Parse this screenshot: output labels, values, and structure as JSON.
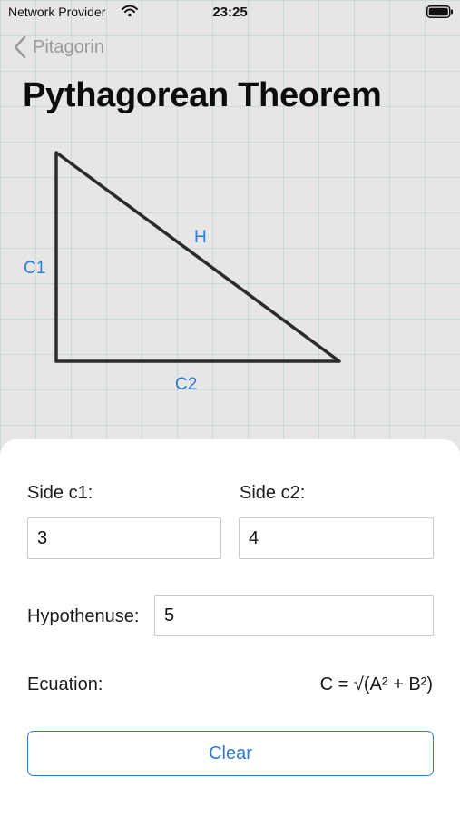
{
  "status_bar": {
    "carrier": "Network Provider",
    "time": "23:25"
  },
  "nav": {
    "back_label": "Pitagorin",
    "title": "Pythagorean Theorem"
  },
  "diagram": {
    "label_c1": "C1",
    "label_h": "H",
    "label_c2": "C2"
  },
  "form": {
    "side1_label": "Side c1:",
    "side1_value": "3",
    "side2_label": "Side c2:",
    "side2_value": "4",
    "hypotenuse_label": "Hypothenuse:",
    "hypotenuse_value": "5",
    "equation_label": "Ecuation:",
    "equation_text": "C = √(A² + B²)",
    "clear_label": "Clear"
  },
  "colors": {
    "accent": "#2f7bd6",
    "background": "#e6e6e6",
    "triangle_stroke": "#2b2b2b"
  },
  "icons": {
    "wifi": "wifi-icon",
    "battery": "battery-icon",
    "back": "chevron-left-icon"
  }
}
